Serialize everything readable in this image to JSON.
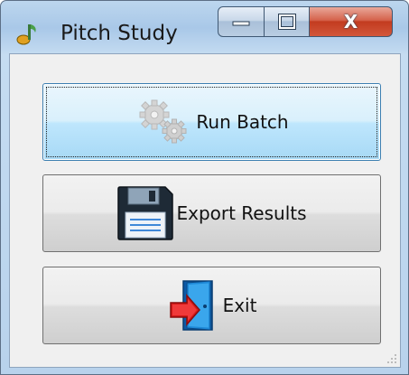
{
  "window": {
    "title": "Pitch Study",
    "app_icon": "music-note-icon",
    "caption_buttons": {
      "minimize_glyph": "—",
      "maximize_glyph": "□",
      "close_glyph": "X"
    }
  },
  "buttons": [
    {
      "label": "Run Batch",
      "icon": "gears-icon",
      "state": "focused"
    },
    {
      "label": "Export Results",
      "icon": "floppy-disk-icon",
      "state": "normal"
    },
    {
      "label": "Exit",
      "icon": "exit-door-icon",
      "state": "normal"
    }
  ],
  "colors": {
    "title_bar": "#b8d2ec",
    "close_button": "#c23b1f",
    "focused_button": "#bee6fd",
    "client_background": "#f0f0f0"
  }
}
